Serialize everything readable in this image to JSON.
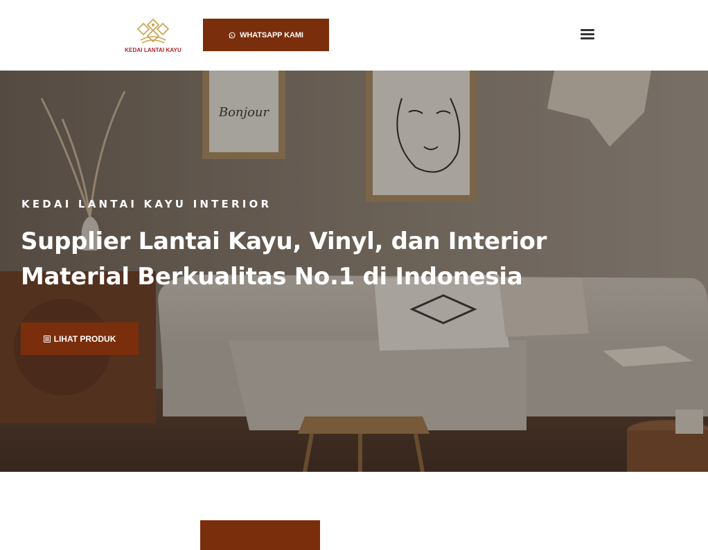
{
  "header": {
    "logo_text": "KEDAI LANTAI KAYU",
    "whatsapp_label": "WHATSAPP KAMI",
    "menu_icon": "hamburger-menu-icon"
  },
  "hero": {
    "eyebrow": "KEDAI LANTAI KAYU INTERIOR",
    "title_line1": "Supplier Lantai Kayu, Vinyl, dan Interior",
    "title_line2": "Material Berkualitas No.1 di Indonesia",
    "cta_label": "LIHAT PRODUK",
    "cta_icon": "list-icon",
    "frame_text": "Bonjour"
  },
  "colors": {
    "brand": "#7a2e0c",
    "logo_gold": "#c9a24a",
    "logo_red": "#b0242c"
  }
}
